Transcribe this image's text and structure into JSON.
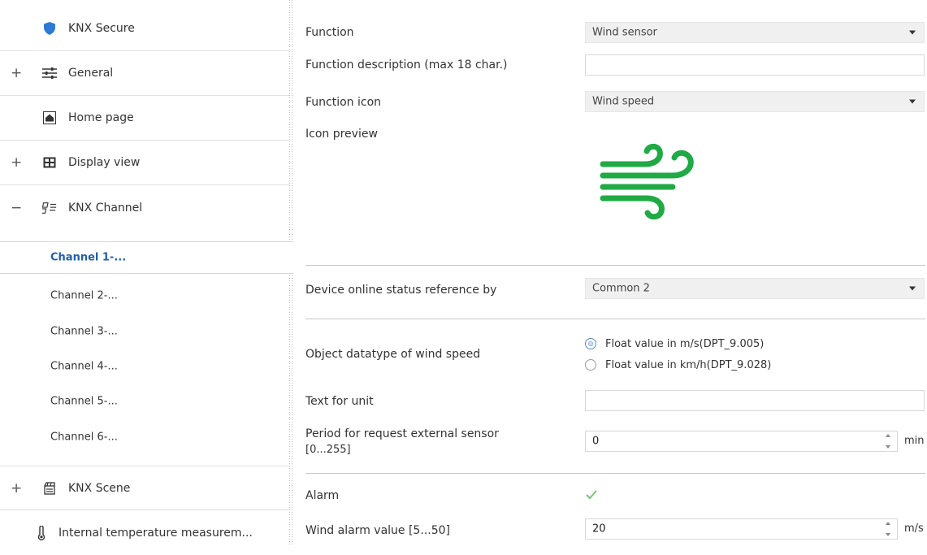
{
  "sidebar": {
    "items": [
      {
        "label": "KNX Secure",
        "icon": "shield-icon",
        "expander": ""
      },
      {
        "label": "General",
        "icon": "sliders-icon",
        "expander": "+"
      },
      {
        "label": "Home page",
        "icon": "home-icon",
        "expander": ""
      },
      {
        "label": "Display view",
        "icon": "grid-icon",
        "expander": "+"
      },
      {
        "label": "KNX Channel",
        "icon": "channel-icon",
        "expander": "−"
      }
    ],
    "channels": [
      "Channel 1-...",
      "Channel 2-...",
      "Channel 3-...",
      "Channel 4-...",
      "Channel 5-...",
      "Channel 6-..."
    ],
    "scene": {
      "label": "KNX Scene",
      "icon": "scene-icon",
      "expander": "+"
    },
    "internal": {
      "label": "Internal temperature measurem...",
      "icon": "thermometer-icon"
    }
  },
  "params": {
    "function": {
      "label": "Function",
      "value": "Wind sensor"
    },
    "description": {
      "label": "Function description (max 18 char.)",
      "value": ""
    },
    "icon": {
      "label": "Function icon",
      "value": "Wind speed"
    },
    "preview": {
      "label": "Icon preview",
      "icon": "wind-icon",
      "color": "#1faa44"
    },
    "online_status": {
      "label": "Device online status reference by",
      "value": "Common 2"
    },
    "datatype": {
      "label": "Object datatype of wind speed",
      "options": [
        "Float value in m/s(DPT_9.005)",
        "Float value in km/h(DPT_9.028)"
      ],
      "selected": 0
    },
    "unit_text": {
      "label": "Text for unit",
      "value": ""
    },
    "period": {
      "label_line1": "Period for request external sensor",
      "label_line2": "[0...255]",
      "value": "0",
      "unit": "min"
    },
    "alarm": {
      "label": "Alarm",
      "checked": true
    },
    "wind_alarm": {
      "label": "Wind alarm value [5...50]",
      "value": "20",
      "unit": "m/s"
    }
  },
  "colors": {
    "accent": "#1f5fa8",
    "check": "#7ac27a"
  }
}
